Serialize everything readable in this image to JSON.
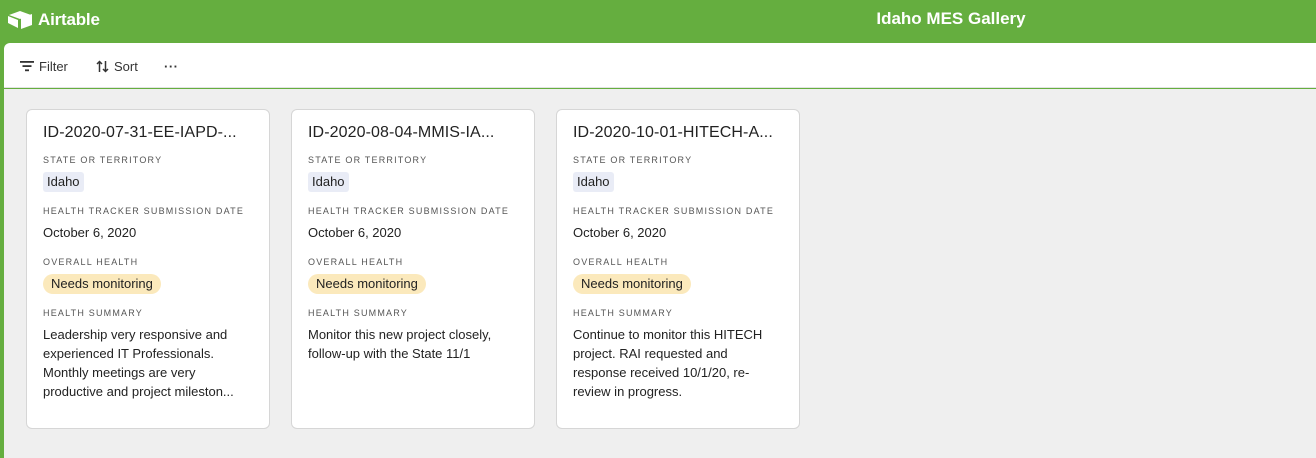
{
  "app": {
    "logo_label": "Airtable",
    "title": "Idaho MES Gallery",
    "brand_color": "#65ae3f"
  },
  "toolbar": {
    "filter_label": "Filter",
    "sort_label": "Sort",
    "more_label": "···"
  },
  "labels": {
    "state": "STATE OR TERRITORY",
    "date": "HEALTH TRACKER SUBMISSION DATE",
    "health": "OVERALL HEALTH",
    "summary": "HEALTH SUMMARY"
  },
  "cards": [
    {
      "title": "ID-2020-07-31-EE-IAPD-...",
      "state": "Idaho",
      "date": "October 6, 2020",
      "health": "Needs monitoring",
      "summary": "Leadership very responsive and experienced IT Professionals. Monthly meetings are very productive and project mileston..."
    },
    {
      "title": "ID-2020-08-04-MMIS-IA...",
      "state": "Idaho",
      "date": "October 6, 2020",
      "health": "Needs monitoring",
      "summary": "Monitor this new project closely, follow-up with the State 11/1"
    },
    {
      "title": "ID-2020-10-01-HITECH-A...",
      "state": "Idaho",
      "date": "October 6, 2020",
      "health": "Needs monitoring",
      "summary": "Continue to monitor this HITECH project. RAI requested and response received 10/1/20, re-review in progress."
    }
  ]
}
